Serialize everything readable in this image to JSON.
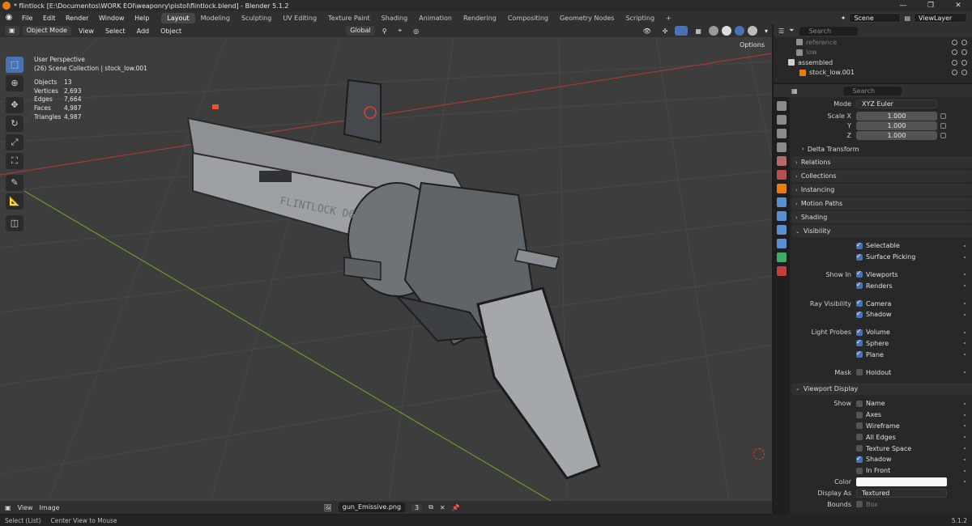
{
  "window": {
    "title": "* flintlock [E:\\Documentos\\WORK EOI\\weaponry\\pistol\\flintlock.blend] - Blender 5.1.2",
    "controls": [
      "—",
      "❐",
      "✕"
    ]
  },
  "menu": [
    "File",
    "Edit",
    "Render",
    "Window",
    "Help"
  ],
  "workspaces": [
    "Layout",
    "Modeling",
    "Sculpting",
    "UV Editing",
    "Texture Paint",
    "Shading",
    "Animation",
    "Rendering",
    "Compositing",
    "Geometry Nodes",
    "Scripting"
  ],
  "active_workspace": "Layout",
  "scene": "Scene",
  "view_layer": "ViewLayer",
  "viewport_header": {
    "mode": "Object Mode",
    "menus": [
      "View",
      "Select",
      "Add",
      "Object"
    ],
    "orientation": "Global",
    "options": "Options"
  },
  "viewport": {
    "view_name": "User Perspective",
    "collection_path": "(26) Scene Collection | stock_low.001",
    "stats": [
      {
        "k": "Objects",
        "v": "13"
      },
      {
        "k": "Vertices",
        "v": "2,693"
      },
      {
        "k": "Edges",
        "v": "7,664"
      },
      {
        "k": "Faces",
        "v": "4,987"
      },
      {
        "k": "Triangles",
        "v": "4,987"
      }
    ],
    "model_text": "FLINTLOCK D636"
  },
  "outliner": {
    "search_placeholder": "Search",
    "items": [
      {
        "name": "reference",
        "dim": true
      },
      {
        "name": "low",
        "dim": true
      },
      {
        "name": "assembled",
        "dim": false
      },
      {
        "name": "stock_low.001",
        "dim": false
      }
    ]
  },
  "properties": {
    "search_placeholder": "Search",
    "rotation_mode_label": "Mode",
    "rotation_mode": "XYZ Euler",
    "scale": [
      {
        "axis": "Scale X",
        "value": "1.000"
      },
      {
        "axis": "Y",
        "value": "1.000"
      },
      {
        "axis": "Z",
        "value": "1.000"
      }
    ],
    "delta_transform": "Delta Transform",
    "panels": [
      "Relations",
      "Collections",
      "Instancing",
      "Motion Paths",
      "Shading",
      "Visibility"
    ],
    "visibility": {
      "selectable": "Selectable",
      "surface_picking": "Surface Picking",
      "show_in_label": "Show In",
      "viewports": "Viewports",
      "renders": "Renders",
      "ray_visibility_label": "Ray Visibility",
      "camera": "Camera",
      "shadow": "Shadow",
      "light_probes_label": "Light Probes",
      "volume": "Volume",
      "sphere": "Sphere",
      "plane": "Plane",
      "mask_label": "Mask",
      "holdout": "Holdout"
    },
    "viewport_display": {
      "title": "Viewport Display",
      "show_label": "Show",
      "name": "Name",
      "axes": "Axes",
      "wireframe": "Wireframe",
      "all_edges": "All Edges",
      "texture_space": "Texture Space",
      "shadow": "Shadow",
      "in_front": "In Front",
      "color_label": "Color",
      "display_as_label": "Display As",
      "display_as": "Textured",
      "bounds_label": "Bounds",
      "bounds": "Box"
    }
  },
  "image_editor": {
    "menus": [
      "View",
      "Image"
    ],
    "image_name": "gun_Emissive.png",
    "users": "3"
  },
  "status": {
    "left1": "Select (List)",
    "left2": "Center View to Mouse",
    "version": "5.1.2"
  }
}
